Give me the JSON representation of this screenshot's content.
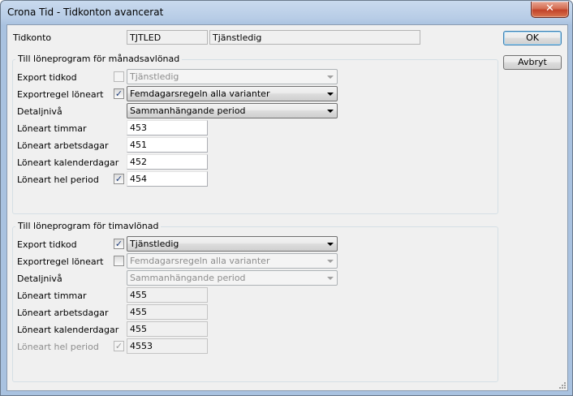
{
  "window": {
    "title": "Crona Tid - Tidkonton avancerat",
    "close_glyph": "✕"
  },
  "header": {
    "tidkonto_label": "Tidkonto",
    "code_value": "TJTLED",
    "name_value": "Tjänstledig"
  },
  "buttons": {
    "ok": "OK",
    "cancel": "Avbryt"
  },
  "monthly": {
    "title": "Till löneprogram för månadsavlönad",
    "export_tidkod": {
      "label": "Export tidkod",
      "checked": false,
      "value": "Tjänstledig",
      "enabled": false
    },
    "exportregel": {
      "label": "Exportregel löneart",
      "checked": true,
      "value": "Femdagarsregeln alla varianter",
      "enabled": true
    },
    "detaljniva": {
      "label": "Detaljnivå",
      "value": "Sammanhängande period",
      "enabled": true
    },
    "loneart_timmar": {
      "label": "Löneart timmar",
      "value": "453"
    },
    "loneart_arbetsdagar": {
      "label": "Löneart arbetsdagar",
      "value": "451"
    },
    "loneart_kalenderdagar": {
      "label": "Löneart kalenderdagar",
      "value": "452"
    },
    "loneart_hel_period": {
      "label": "Löneart hel period",
      "checked": true,
      "value": "454"
    }
  },
  "hourly": {
    "title": "Till löneprogram för timavlönad",
    "export_tidkod": {
      "label": "Export tidkod",
      "checked": true,
      "value": "Tjänstledig",
      "enabled": true
    },
    "exportregel": {
      "label": "Exportregel löneart",
      "checked": false,
      "value": "Femdagarsregeln alla varianter",
      "enabled": false
    },
    "detaljniva": {
      "label": "Detaljnivå",
      "value": "Sammanhängande period",
      "enabled": false
    },
    "loneart_timmar": {
      "label": "Löneart timmar",
      "value": "455"
    },
    "loneart_arbetsdagar": {
      "label": "Löneart arbetsdagar",
      "value": "455"
    },
    "loneart_kalenderdagar": {
      "label": "Löneart kalenderdagar",
      "value": "455"
    },
    "loneart_hel_period": {
      "label": "Löneart hel period",
      "checked": true,
      "value": "4553"
    }
  },
  "glyphs": {
    "check": "✓"
  },
  "icons": {
    "close": "close-icon",
    "dropdown": "chevron-down-icon",
    "grip": "resize-grip-icon"
  }
}
